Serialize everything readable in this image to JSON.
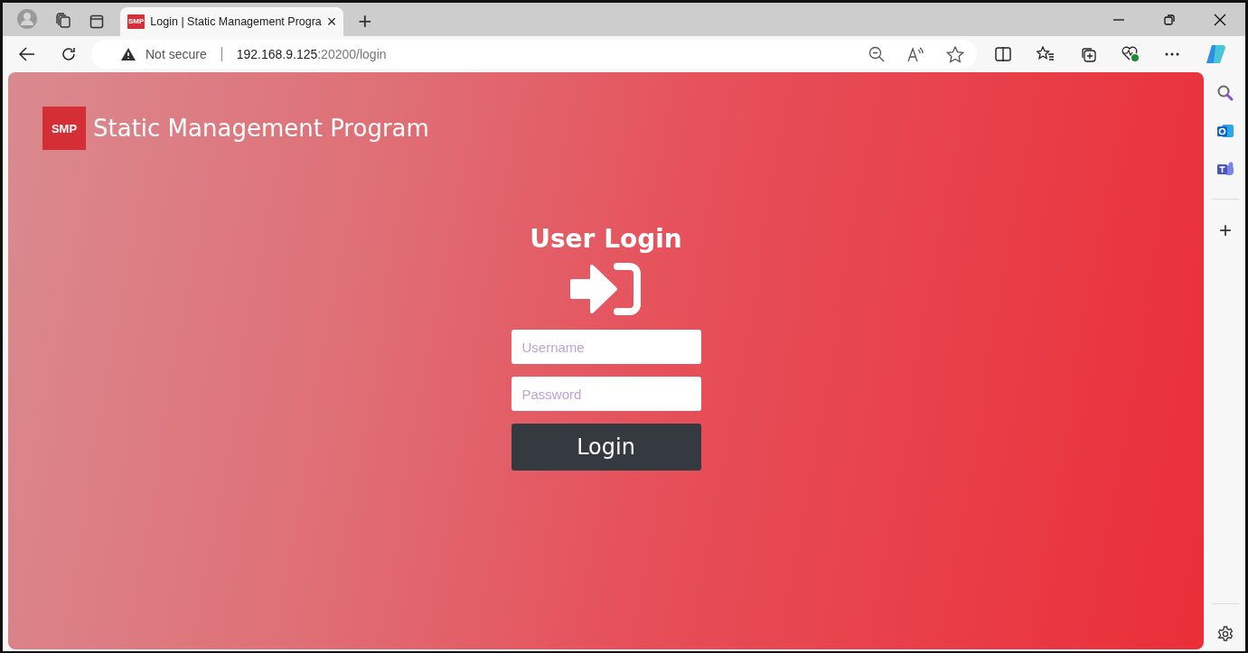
{
  "browser": {
    "tab": {
      "title": "Login | Static Management Progra",
      "logo_text": "SMP",
      "close": "×",
      "selected": true
    },
    "new_tab": "+",
    "security": "Not secure",
    "url_host": "192.168.9.125",
    "url_rest": ":20200/login"
  },
  "page": {
    "logo_text": "SMP",
    "app_title": "Static Management Program",
    "heading": "User Login",
    "username": {
      "placeholder": "Username"
    },
    "password": {
      "placeholder": "Password"
    },
    "login_button": "Login"
  },
  "sidebar": {
    "add": "+"
  }
}
